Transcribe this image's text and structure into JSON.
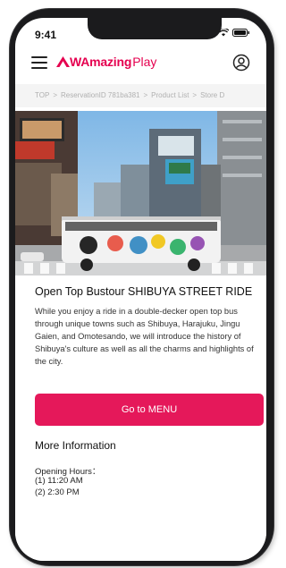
{
  "status_bar": {
    "time": "9:41"
  },
  "header": {
    "logo_prefix": "WAmazing",
    "logo_suffix": "Play"
  },
  "breadcrumb": {
    "items": [
      "TOP",
      "ReservationID 781ba381",
      "Product List",
      "Store D"
    ],
    "separator": ">"
  },
  "product": {
    "title": "Open Top Bustour SHIBUYA STREET RIDE",
    "description": "While you enjoy a ride in a double-decker open top bus through unique towns such as Shibuya, Harajuku, Jingu Gaien, and Omotesando, we will introduce the history of Shibuya's culture as well as all the charms and highlights of the city.",
    "cta_label": "Go to MENU"
  },
  "more_info": {
    "heading": "More Information",
    "opening_hours_label": "Opening Hours：",
    "hours": [
      "(1) 11:20 AM",
      "(2) 2:30 PM"
    ]
  },
  "colors": {
    "brand": "#e5004f",
    "button": "#e5185a"
  },
  "icons": {
    "menu": "hamburger-icon",
    "user": "user-account-icon",
    "logo": "wamazing-a-logo-icon"
  }
}
